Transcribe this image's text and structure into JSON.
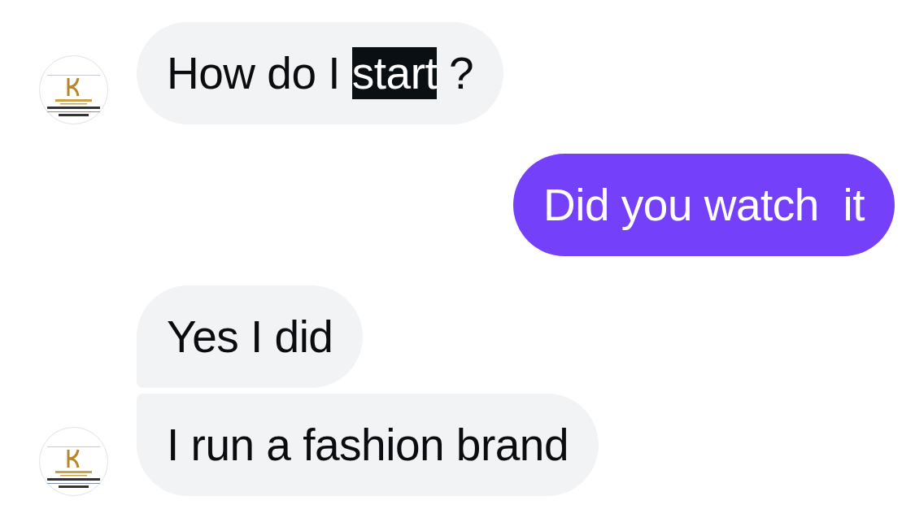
{
  "messages": [
    {
      "kind": "received",
      "avatar": true,
      "joined_above": false,
      "joined_below": false,
      "segments": [
        {
          "text": "How do I ",
          "highlighted": false
        },
        {
          "text": "start",
          "highlighted": true
        },
        {
          "text": " ?",
          "highlighted": false
        }
      ]
    },
    {
      "kind": "sent",
      "joined_above": false,
      "joined_below": false,
      "segments": [
        {
          "text": "Did you watch  it",
          "highlighted": false
        }
      ]
    },
    {
      "kind": "received",
      "avatar": false,
      "joined_above": false,
      "joined_below": true,
      "segments": [
        {
          "text": "Yes I did",
          "highlighted": false
        }
      ]
    },
    {
      "kind": "received",
      "avatar": true,
      "joined_above": true,
      "joined_below": false,
      "segments": [
        {
          "text": "I run a fashion brand",
          "highlighted": false
        }
      ]
    }
  ]
}
